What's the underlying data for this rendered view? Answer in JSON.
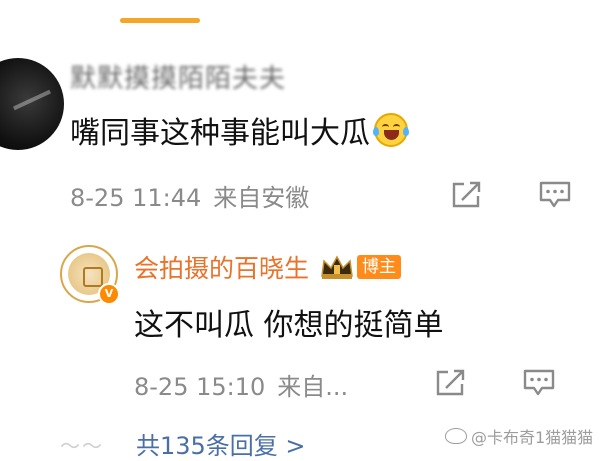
{
  "comment": {
    "username": "默默摸摸陌陌夫夫",
    "text": "嘴同事这种事能叫大瓜",
    "emoji": "laughing-crying-emoji",
    "time": "8-25 11:44",
    "location": "来自安徽"
  },
  "reply": {
    "username": "会拍摄的百晓生",
    "badge": "博主",
    "text": "这不叫瓜 你想的挺简单",
    "time": "8-25 15:10",
    "location": "来自...",
    "verified_mark": "V"
  },
  "more_replies": "共135条回复 >",
  "watermark": "@卡布奇1猫猫猫",
  "colors": {
    "accent": "#f5a623",
    "username_highlight": "#e8732a",
    "badge_bg": "#ff8c1a",
    "link": "#4a6fa5",
    "meta": "#8a8a8a"
  },
  "icons": [
    "share-icon",
    "reply-icon",
    "crown-icon",
    "verified-badge-icon",
    "weibo-logo-icon"
  ]
}
